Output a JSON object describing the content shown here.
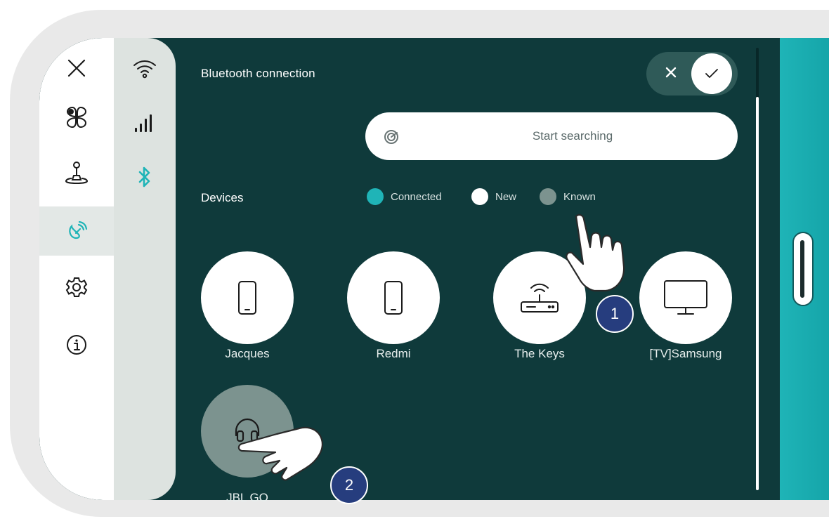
{
  "header": {
    "title": "Bluetooth connection"
  },
  "search": {
    "label": "Start searching"
  },
  "devices": {
    "label": "Devices",
    "legend": [
      {
        "label": "Connected",
        "color": "#1fb4b7"
      },
      {
        "label": "New",
        "color": "#ffffff"
      },
      {
        "label": "Known",
        "color": "#7c938f"
      }
    ],
    "items": [
      {
        "name": "Jacques",
        "icon": "smartphone-icon",
        "status": "new"
      },
      {
        "name": "Redmi",
        "icon": "smartphone-icon",
        "status": "new"
      },
      {
        "name": "The Keys",
        "icon": "router-icon",
        "status": "new"
      },
      {
        "name": "[TV]Samsung",
        "icon": "tv-icon",
        "status": "new"
      },
      {
        "name": "JBL GO",
        "icon": "headphones-icon",
        "status": "known"
      }
    ]
  },
  "nav": {
    "primary": [
      "close-icon",
      "dashboard-icon",
      "joystick-icon",
      "connectivity-icon",
      "settings-icon",
      "info-icon"
    ],
    "secondary": [
      "wifi-icon",
      "cellular-signal-icon",
      "bluetooth-icon"
    ],
    "active": "connectivity-icon"
  },
  "callouts": [
    "1",
    "2"
  ],
  "colors": {
    "accent": "#1fb4b7",
    "background": "#0f3a3b",
    "callout": "#263d7e"
  }
}
